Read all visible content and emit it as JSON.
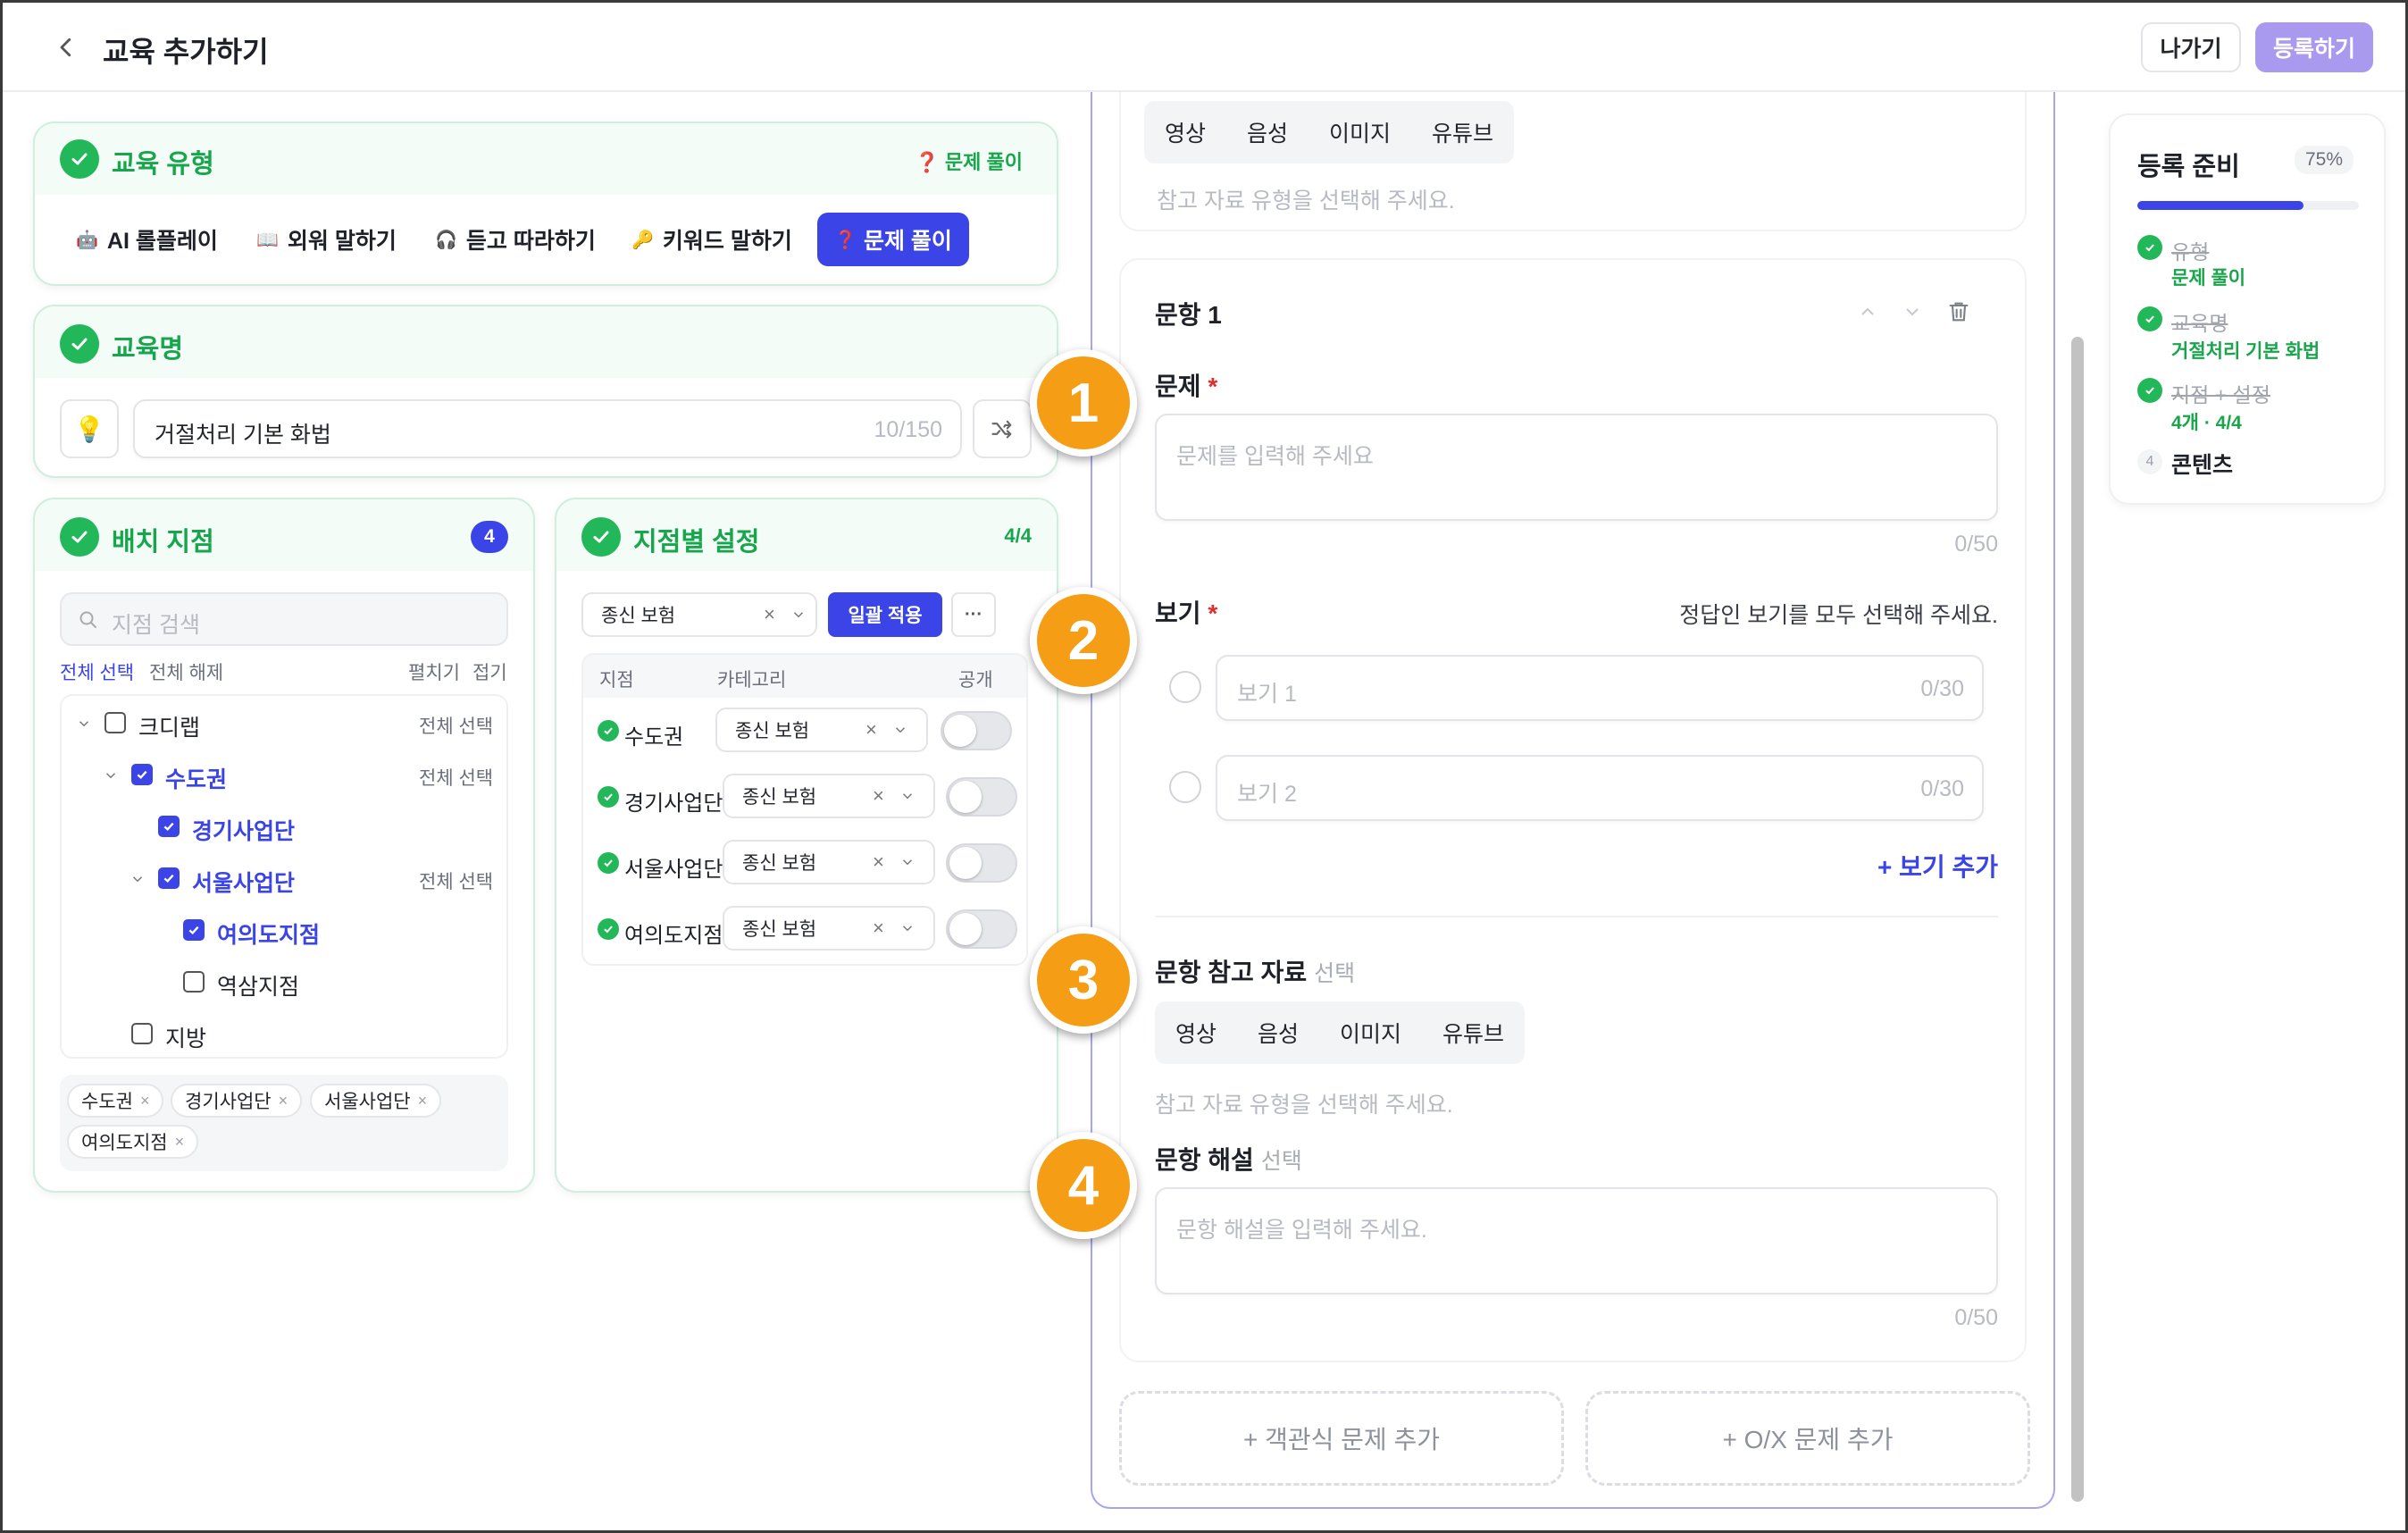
{
  "header": {
    "title": "교육 추가하기",
    "exit_label": "나가기",
    "register_label": "등록하기"
  },
  "edu_type": {
    "title": "교육 유형",
    "selected_tag": "❓ 문제 풀이",
    "options": [
      {
        "icon": "🤖",
        "label": "AI 롤플레이"
      },
      {
        "icon": "📖",
        "label": "외워 말하기"
      },
      {
        "icon": "🎧",
        "label": "듣고 따라하기"
      },
      {
        "icon": "🔑",
        "label": "키워드 말하기"
      },
      {
        "icon": "❓",
        "label": "문제 풀이"
      }
    ]
  },
  "edu_name": {
    "title": "교육명",
    "value": "거절처리 기본 화법",
    "counter": "10/150",
    "bulb_icon": "💡"
  },
  "branches": {
    "title": "배치 지점",
    "count": "4",
    "search_placeholder": "지점 검색",
    "select_all": "전체 선택",
    "deselect_all": "전체 해제",
    "expand": "펼치기",
    "collapse": "접기",
    "tree": [
      {
        "label": "크디랩",
        "action": "전체 선택"
      },
      {
        "label": "수도권",
        "action": "전체 선택"
      },
      {
        "label": "경기사업단"
      },
      {
        "label": "서울사업단",
        "action": "전체 선택"
      },
      {
        "label": "여의도지점"
      },
      {
        "label": "역삼지점"
      },
      {
        "label": "지방"
      }
    ],
    "chips": [
      "수도권",
      "경기사업단",
      "서울사업단",
      "여의도지점"
    ],
    "chip_remove": "×"
  },
  "branch_settings": {
    "title": "지점별 설정",
    "count": "4/4",
    "bulk_value": "종신 보험",
    "apply_label": "일괄 적용",
    "more": "···",
    "columns": [
      "지점",
      "카테고리",
      "공개"
    ],
    "rows": [
      {
        "name": "수도권",
        "category": "종신 보험"
      },
      {
        "name": "경기사업단",
        "category": "종신 보험"
      },
      {
        "name": "서울사업단",
        "category": "종신 보험"
      },
      {
        "name": "여의도지점",
        "category": "종신 보험"
      }
    ],
    "clear": "×"
  },
  "editor": {
    "top_ref_tabs": [
      "영상",
      "음성",
      "이미지",
      "유튜브"
    ],
    "top_ref_hint": "참고 자료 유형을 선택해 주세요.",
    "question_title": "문항 1",
    "question_label": "문제",
    "required": "*",
    "question_placeholder": "문제를 입력해 주세요",
    "question_counter": "0/50",
    "choices_label": "보기",
    "choices_hint": "정답인 보기를 모두 선택해 주세요.",
    "choices": [
      {
        "placeholder": "보기 1",
        "counter": "0/30"
      },
      {
        "placeholder": "보기 2",
        "counter": "0/30"
      }
    ],
    "add_choice": "+ 보기 추가",
    "ref_label": "문항 참고 자료",
    "optional": "선택",
    "ref_tabs": [
      "영상",
      "음성",
      "이미지",
      "유튜브"
    ],
    "ref_hint": "참고 자료 유형을 선택해 주세요.",
    "explain_label": "문항 해설",
    "explain_placeholder": "문항 해설을 입력해 주세요.",
    "explain_counter": "0/50",
    "add_mc": "+ 객관식 문제 추가",
    "add_ox": "+ O/X 문제 추가",
    "badges": [
      "1",
      "2",
      "3",
      "4"
    ]
  },
  "progress": {
    "title": "등록 준비",
    "percent_label": "75%",
    "percent": 0.75,
    "steps": [
      {
        "label": "유형",
        "value": "문제 풀이"
      },
      {
        "label": "교육명",
        "value": "거절처리 기본 화법"
      },
      {
        "label": "지점 + 설정",
        "value": "4개 · 4/4"
      },
      {
        "num": "4",
        "label": "콘텐츠"
      }
    ]
  },
  "colors": {
    "accent": "#3b44e6",
    "green": "#22b85a",
    "badge": "#f49d15",
    "register_btn": "#a99af0"
  }
}
